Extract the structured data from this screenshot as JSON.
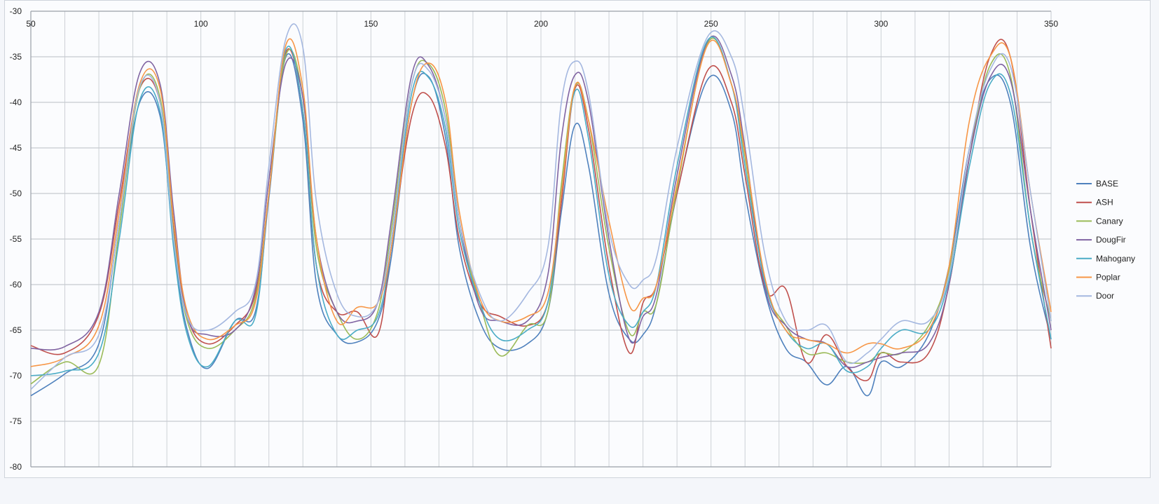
{
  "chart_data": {
    "type": "line",
    "title": "",
    "xlabel": "",
    "ylabel": "",
    "xlim": [
      50,
      350
    ],
    "ylim": [
      -80,
      -30
    ],
    "x_ticks": [
      50,
      100,
      150,
      200,
      250,
      300,
      350
    ],
    "x_tick_labels": [
      "50",
      "100",
      "150",
      "200",
      "250",
      "300",
      "350"
    ],
    "y_ticks": [
      -30,
      -35,
      -40,
      -45,
      -50,
      -55,
      -60,
      -65,
      -70,
      -75,
      -80
    ],
    "y_tick_labels": [
      "-30",
      "-35",
      "-40",
      "-45",
      "-50",
      "-55",
      "-60",
      "-65",
      "-70",
      "-75",
      "-80"
    ],
    "x_minor_step": 10,
    "grid": true,
    "legend_position": "right",
    "x": [
      50,
      60,
      70,
      76,
      82,
      88,
      92,
      96,
      102,
      110,
      116,
      120,
      125,
      130,
      134,
      140,
      146,
      152,
      156,
      162,
      167,
      172,
      176,
      182,
      188,
      196,
      202,
      206,
      210,
      214,
      220,
      226,
      230,
      234,
      240,
      249,
      256,
      260,
      266,
      272,
      278,
      284,
      290,
      296,
      300,
      306,
      314,
      320,
      326,
      332,
      338,
      344,
      350
    ],
    "series": [
      {
        "name": "BASE",
        "color": "#4f81bd",
        "values": [
          -72.2,
          -69.8,
          -66.5,
          -53.0,
          -40.0,
          -41.5,
          -55.5,
          -65.0,
          -69.2,
          -64.0,
          -63.0,
          -50.5,
          -35.0,
          -42.0,
          -60.0,
          -65.5,
          -66.3,
          -64.0,
          -57.0,
          -40.0,
          -37.2,
          -44.0,
          -56.0,
          -64.0,
          -67.0,
          -66.5,
          -63.0,
          -52.0,
          -42.5,
          -47.0,
          -61.0,
          -66.0,
          -65.5,
          -62.0,
          -50.0,
          -37.5,
          -41.0,
          -50.0,
          -61.0,
          -67.0,
          -68.5,
          -71.0,
          -69.0,
          -72.2,
          -68.5,
          -69.0,
          -65.5,
          -58.0,
          -45.0,
          -37.5,
          -40.0,
          -56.0,
          -66.0
        ]
      },
      {
        "name": "ASH",
        "color": "#c0504d",
        "values": [
          -66.7,
          -67.5,
          -63.3,
          -51.0,
          -38.5,
          -40.0,
          -54.0,
          -63.5,
          -66.5,
          -64.5,
          -61.0,
          -50.0,
          -34.5,
          -41.0,
          -58.0,
          -63.0,
          -63.0,
          -65.5,
          -56.0,
          -41.5,
          -39.3,
          -45.0,
          -55.0,
          -62.0,
          -63.5,
          -64.5,
          -62.0,
          -51.0,
          -38.5,
          -43.0,
          -58.0,
          -67.5,
          -62.0,
          -60.0,
          -50.0,
          -36.5,
          -40.0,
          -48.0,
          -60.5,
          -60.5,
          -68.5,
          -65.5,
          -69.0,
          -70.5,
          -67.5,
          -68.5,
          -67.5,
          -60.0,
          -46.0,
          -35.0,
          -35.0,
          -52.0,
          -67.0
        ]
      },
      {
        "name": "Canary",
        "color": "#9bbb59",
        "values": [
          -70.9,
          -68.5,
          -68.8,
          -54.0,
          -38.5,
          -39.5,
          -54.5,
          -64.0,
          -67.0,
          -65.0,
          -61.5,
          -50.0,
          -34.8,
          -39.5,
          -56.0,
          -63.0,
          -66.0,
          -63.0,
          -54.0,
          -38.0,
          -35.8,
          -41.0,
          -53.0,
          -62.0,
          -67.8,
          -64.5,
          -63.0,
          -49.0,
          -38.3,
          -42.0,
          -56.0,
          -65.3,
          -63.0,
          -62.0,
          -49.5,
          -33.5,
          -38.0,
          -46.0,
          -60.0,
          -64.5,
          -67.5,
          -67.5,
          -68.5,
          -68.5,
          -67.5,
          -67.5,
          -64.5,
          -58.5,
          -46.0,
          -36.0,
          -37.0,
          -54.0,
          -64.0
        ]
      },
      {
        "name": "DougFir",
        "color": "#8064a2",
        "values": [
          -67.0,
          -66.8,
          -63.0,
          -50.0,
          -36.8,
          -38.0,
          -52.0,
          -63.5,
          -65.5,
          -65.0,
          -60.5,
          -48.5,
          -35.7,
          -39.5,
          -55.0,
          -63.0,
          -64.0,
          -62.0,
          -53.0,
          -37.0,
          -36.0,
          -42.0,
          -53.0,
          -62.5,
          -64.0,
          -64.0,
          -59.0,
          -44.0,
          -37.0,
          -40.0,
          -55.0,
          -66.0,
          -63.5,
          -61.0,
          -48.0,
          -33.3,
          -37.0,
          -45.0,
          -60.5,
          -64.5,
          -66.0,
          -66.5,
          -69.0,
          -68.5,
          -68.0,
          -67.5,
          -66.5,
          -60.0,
          -46.0,
          -37.3,
          -37.5,
          -52.0,
          -65.0
        ]
      },
      {
        "name": "Mahogany",
        "color": "#4bacc6",
        "values": [
          -70.0,
          -69.5,
          -67.5,
          -55.0,
          -39.8,
          -41.0,
          -56.0,
          -65.5,
          -69.0,
          -64.0,
          -63.5,
          -50.0,
          -34.2,
          -41.0,
          -58.0,
          -65.5,
          -65.0,
          -63.5,
          -56.0,
          -39.0,
          -37.3,
          -43.0,
          -54.0,
          -62.0,
          -66.0,
          -65.0,
          -62.0,
          -50.0,
          -38.8,
          -44.0,
          -59.0,
          -64.5,
          -63.0,
          -60.0,
          -47.0,
          -33.2,
          -38.0,
          -47.0,
          -60.0,
          -65.0,
          -67.0,
          -66.5,
          -69.5,
          -69.0,
          -67.0,
          -65.0,
          -65.0,
          -59.5,
          -47.0,
          -38.0,
          -39.0,
          -54.0,
          -66.0
        ]
      },
      {
        "name": "Poplar",
        "color": "#f79646",
        "values": [
          -69.0,
          -68.0,
          -64.5,
          -52.0,
          -38.0,
          -38.5,
          -53.0,
          -63.0,
          -66.0,
          -64.5,
          -62.0,
          -50.0,
          -33.7,
          -38.5,
          -55.0,
          -64.0,
          -62.5,
          -62.0,
          -56.0,
          -40.0,
          -35.7,
          -40.0,
          -52.0,
          -61.5,
          -64.0,
          -63.5,
          -61.0,
          -50.0,
          -38.2,
          -42.0,
          -53.0,
          -62.3,
          -61.5,
          -60.0,
          -49.0,
          -33.7,
          -38.0,
          -45.5,
          -59.5,
          -65.0,
          -66.0,
          -66.5,
          -67.5,
          -66.5,
          -66.5,
          -67.0,
          -65.0,
          -58.0,
          -42.0,
          -35.0,
          -35.0,
          -50.0,
          -63.0
        ]
      },
      {
        "name": "Door",
        "color": "#a5b8e0",
        "values": [
          -71.5,
          -68.0,
          -65.5,
          -53.0,
          -38.3,
          -40.0,
          -55.0,
          -63.5,
          -65.0,
          -63.0,
          -60.0,
          -47.0,
          -33.0,
          -34.0,
          -51.0,
          -61.0,
          -63.5,
          -62.0,
          -55.0,
          -38.0,
          -36.5,
          -42.0,
          -53.0,
          -61.0,
          -64.0,
          -61.0,
          -56.0,
          -40.0,
          -35.5,
          -39.0,
          -54.0,
          -60.0,
          -59.5,
          -57.0,
          -45.0,
          -32.8,
          -35.0,
          -42.0,
          -57.0,
          -64.0,
          -65.0,
          -64.5,
          -68.5,
          -67.5,
          -66.0,
          -64.0,
          -64.0,
          -59.0,
          -45.0,
          -36.5,
          -36.0,
          -50.0,
          -64.0
        ]
      }
    ]
  }
}
